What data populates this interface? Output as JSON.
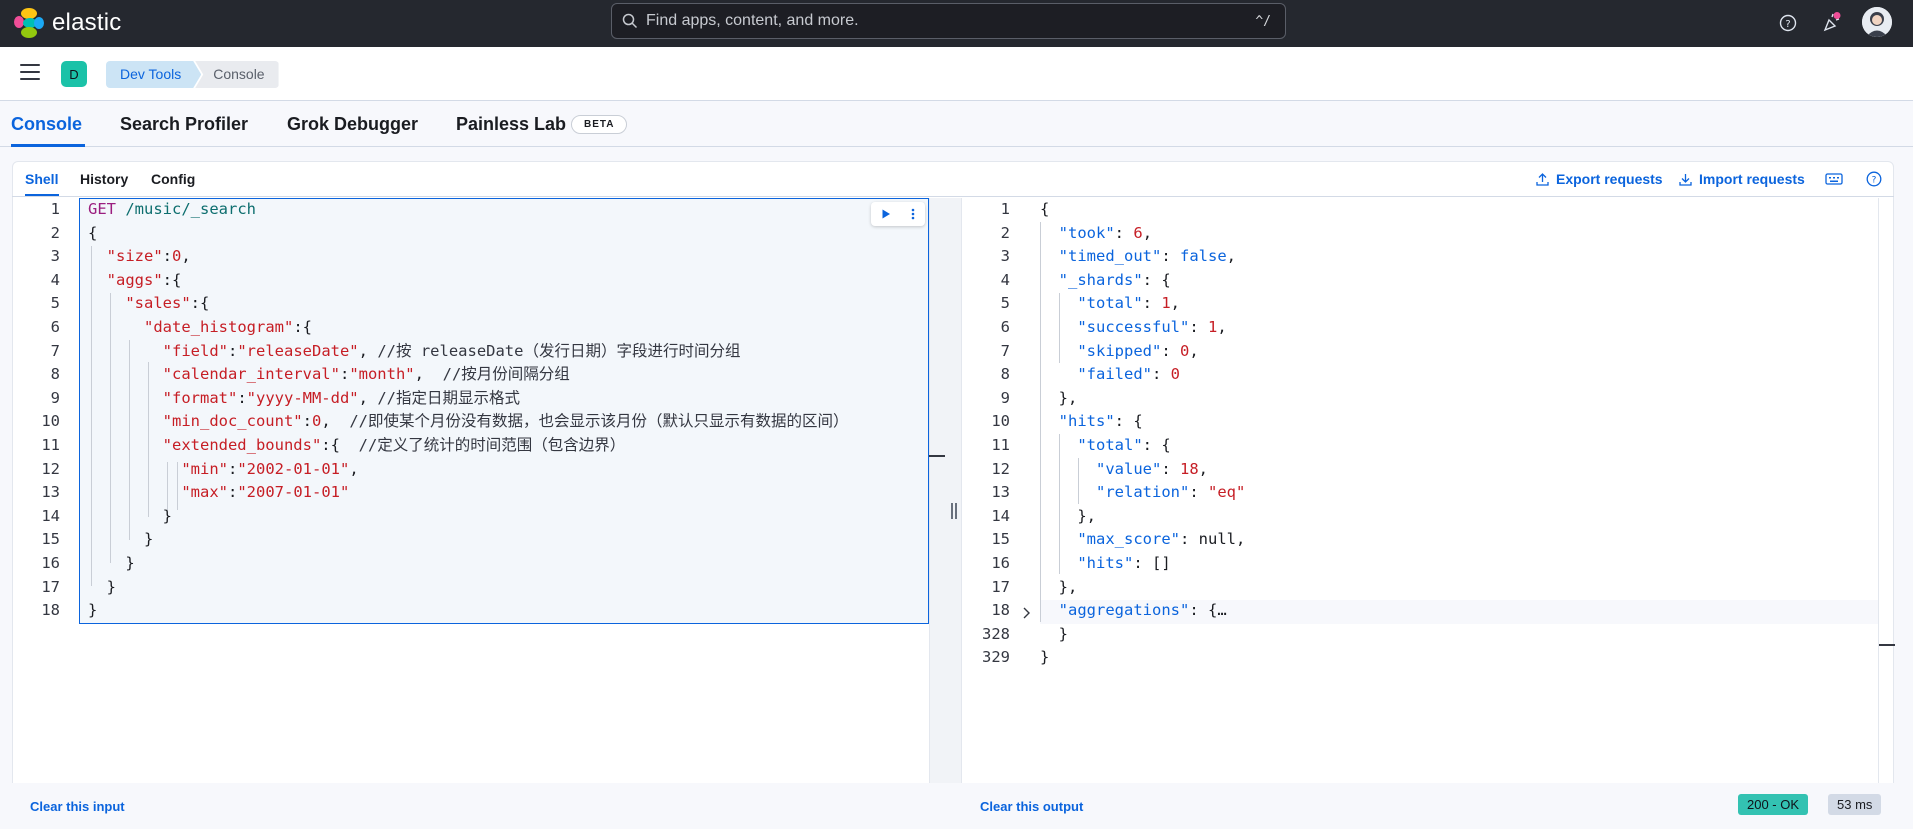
{
  "header": {
    "brand": "elastic",
    "search_placeholder": "Find apps, content, and more.",
    "search_shortcut": "^/"
  },
  "breadcrumb": {
    "space_initial": "D",
    "items": [
      "Dev Tools",
      "Console"
    ]
  },
  "app_tabs": {
    "items": [
      "Console",
      "Search Profiler",
      "Grok Debugger",
      "Painless Lab"
    ],
    "active": "Console",
    "beta_label": "BETA"
  },
  "console_tabs": {
    "items": [
      "Shell",
      "History",
      "Config"
    ],
    "active": "Shell",
    "export_label": "Export requests",
    "import_label": "Import requests"
  },
  "request": {
    "line_numbers": [
      "1",
      "2",
      "3",
      "4",
      "5",
      "6",
      "7",
      "8",
      "9",
      "10",
      "11",
      "12",
      "13",
      "14",
      "15",
      "16",
      "17",
      "18"
    ],
    "method": "GET",
    "path": "/music/_search",
    "size": "0",
    "field_value": "\"releaseDate\"",
    "field_comment": "//按 releaseDate（发行日期）字段进行时间分组",
    "interval_value": "\"month\"",
    "interval_comment": "//按月份间隔分组",
    "format_value": "\"yyyy-MM-dd\"",
    "format_comment": "//指定日期显示格式",
    "min_doc_count": "0",
    "min_doc_comment": "//即使某个月份没有数据，也会显示该月份（默认只显示有数据的区间）",
    "bounds_comment": "//定义了统计的时间范围（包含边界）",
    "min_value": "\"2002-01-01\"",
    "max_value": "\"2007-01-01\""
  },
  "response": {
    "line_numbers": [
      "1",
      "2",
      "3",
      "4",
      "5",
      "6",
      "7",
      "8",
      "9",
      "10",
      "11",
      "12",
      "13",
      "14",
      "15",
      "16",
      "17",
      "18",
      "328",
      "329"
    ],
    "took": "6",
    "timed_out": "false",
    "shards_total": "1",
    "shards_successful": "1",
    "shards_skipped": "0",
    "shards_failed": "0",
    "hits_total_value": "18",
    "hits_total_relation": "\"eq\"",
    "max_score": "null",
    "hits_hits": "[]",
    "aggregations_collapsed": "{…"
  },
  "footer": {
    "clear_input": "Clear this input",
    "clear_output": "Clear this output",
    "status": "200 - OK",
    "duration": "53 ms"
  },
  "colors": {
    "header_bg": "#25282f",
    "accent": "#0b64dd",
    "status_ok_bg": "#33c2b2",
    "string_value": "#c61e25"
  }
}
